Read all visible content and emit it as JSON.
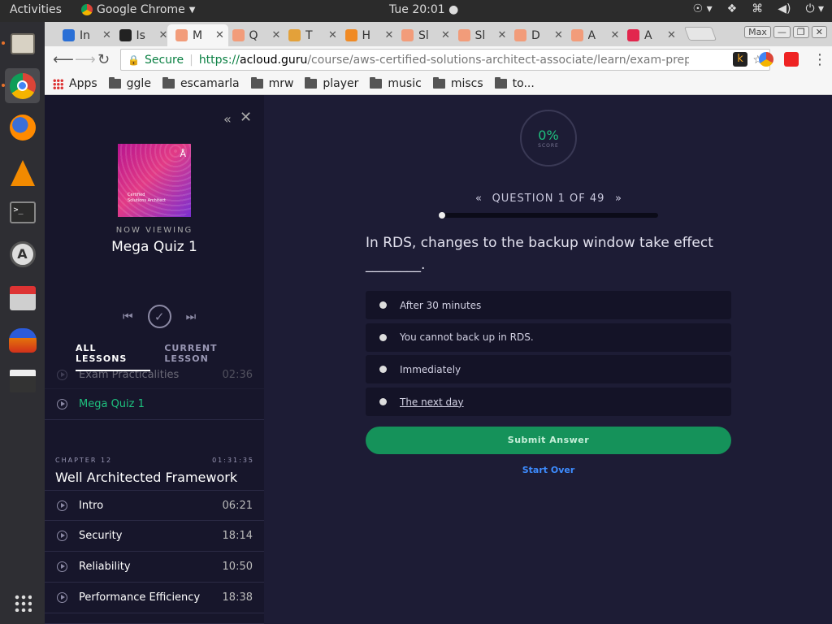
{
  "topbar": {
    "activities": "Activities",
    "app_name": "Google Chrome",
    "clock": "Tue 20:01"
  },
  "dock": {
    "apps": [
      "files-icon",
      "chrome-icon",
      "firefox-icon",
      "vlc-icon",
      "terminal-icon",
      "software-updater-icon",
      "installer-icon",
      "audacity-icon",
      "clapper-icon",
      "app-grid-icon"
    ]
  },
  "tabs": [
    {
      "label": "In",
      "color": "#2a6fd6"
    },
    {
      "label": "Is",
      "color": "#222222"
    },
    {
      "label": "M",
      "color": "#f29c7a"
    },
    {
      "label": "Q",
      "color": "#f29c7a"
    },
    {
      "label": "T",
      "color": "#e3a13a"
    },
    {
      "label": "H",
      "color": "#f08a24"
    },
    {
      "label": "Sl",
      "color": "#f29c7a"
    },
    {
      "label": "Sl",
      "color": "#f29c7a"
    },
    {
      "label": "D",
      "color": "#f29c7a"
    },
    {
      "label": "A",
      "color": "#f29c7a"
    },
    {
      "label": "A",
      "color": "#e2264d"
    }
  ],
  "window": {
    "max_label": "Max"
  },
  "omnibox": {
    "secure": "Secure",
    "scheme": "https://",
    "host": "acloud.guru",
    "path": "/course/aws-certified-solutions-architect-associate/learn/exam-preparati..."
  },
  "bookmarks": [
    {
      "label": "Apps",
      "type": "apps"
    },
    {
      "label": "ggle",
      "type": "folder"
    },
    {
      "label": "escamarla",
      "type": "folder"
    },
    {
      "label": "mrw",
      "type": "folder"
    },
    {
      "label": "player",
      "type": "folder"
    },
    {
      "label": "music",
      "type": "folder"
    },
    {
      "label": "miscs",
      "type": "folder"
    },
    {
      "label": "to...",
      "type": "folder"
    }
  ],
  "sidebar": {
    "cover": {
      "line1": "Certified",
      "line2": "Solutions Architect"
    },
    "now_viewing": "NOW VIEWING",
    "current_title": "Mega Quiz 1",
    "tabs": [
      "ALL LESSONS",
      "CURRENT LESSON"
    ],
    "partial_row": {
      "name": "Exam Practicalities",
      "duration": "02:36"
    },
    "active_row": {
      "name": "Mega Quiz 1"
    },
    "chapter": {
      "label": "CHAPTER 12",
      "time": "01:31:35",
      "title": "Well Architected Framework"
    },
    "lessons": [
      {
        "name": "Intro",
        "duration": "06:21"
      },
      {
        "name": "Security",
        "duration": "18:14"
      },
      {
        "name": "Reliability",
        "duration": "10:50"
      },
      {
        "name": "Performance Efficiency",
        "duration": "18:38"
      }
    ]
  },
  "quiz": {
    "score": "0%",
    "score_label": "SCORE",
    "question_label": "QUESTION 1 OF 49",
    "progress": 0,
    "question": "In RDS, changes to the backup window take effect ________.",
    "answers": [
      "After 30 minutes",
      "You cannot back up in RDS.",
      "Immediately",
      "The next day"
    ],
    "submit": "Submit Answer",
    "start_over": "Start Over"
  },
  "colors": {
    "accent": "#1ec07e",
    "submit": "#15925a",
    "link": "#3d8cff"
  }
}
